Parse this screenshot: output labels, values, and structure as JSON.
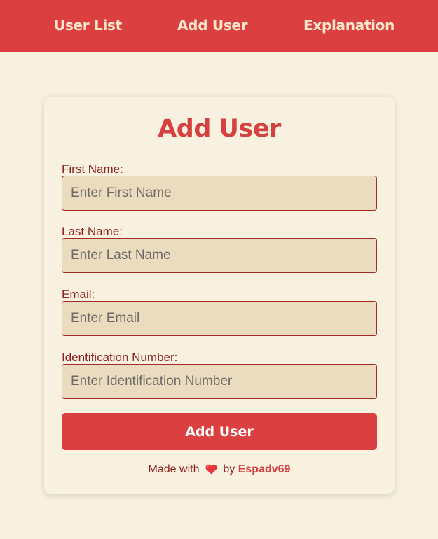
{
  "nav": {
    "user_list": "User List",
    "add_user": "Add User",
    "explanation": "Explanation"
  },
  "form": {
    "title": "Add User",
    "first_name": {
      "label": "First Name:",
      "placeholder": "Enter First Name",
      "value": ""
    },
    "last_name": {
      "label": "Last Name:",
      "placeholder": "Enter Last Name",
      "value": ""
    },
    "email": {
      "label": "Email:",
      "placeholder": "Enter Email",
      "value": ""
    },
    "id_number": {
      "label": "Identification Number:",
      "placeholder": "Enter Identification Number",
      "value": ""
    },
    "submit_label": "Add User"
  },
  "footer": {
    "made_with": "Made with",
    "by": "by",
    "author": "Espadv69",
    "heart_icon": "heart-icon"
  },
  "colors": {
    "primary": "#dc3f3f",
    "background": "#f9f1df",
    "input_bg": "#ecdcbf",
    "label": "#8f1f1f"
  }
}
